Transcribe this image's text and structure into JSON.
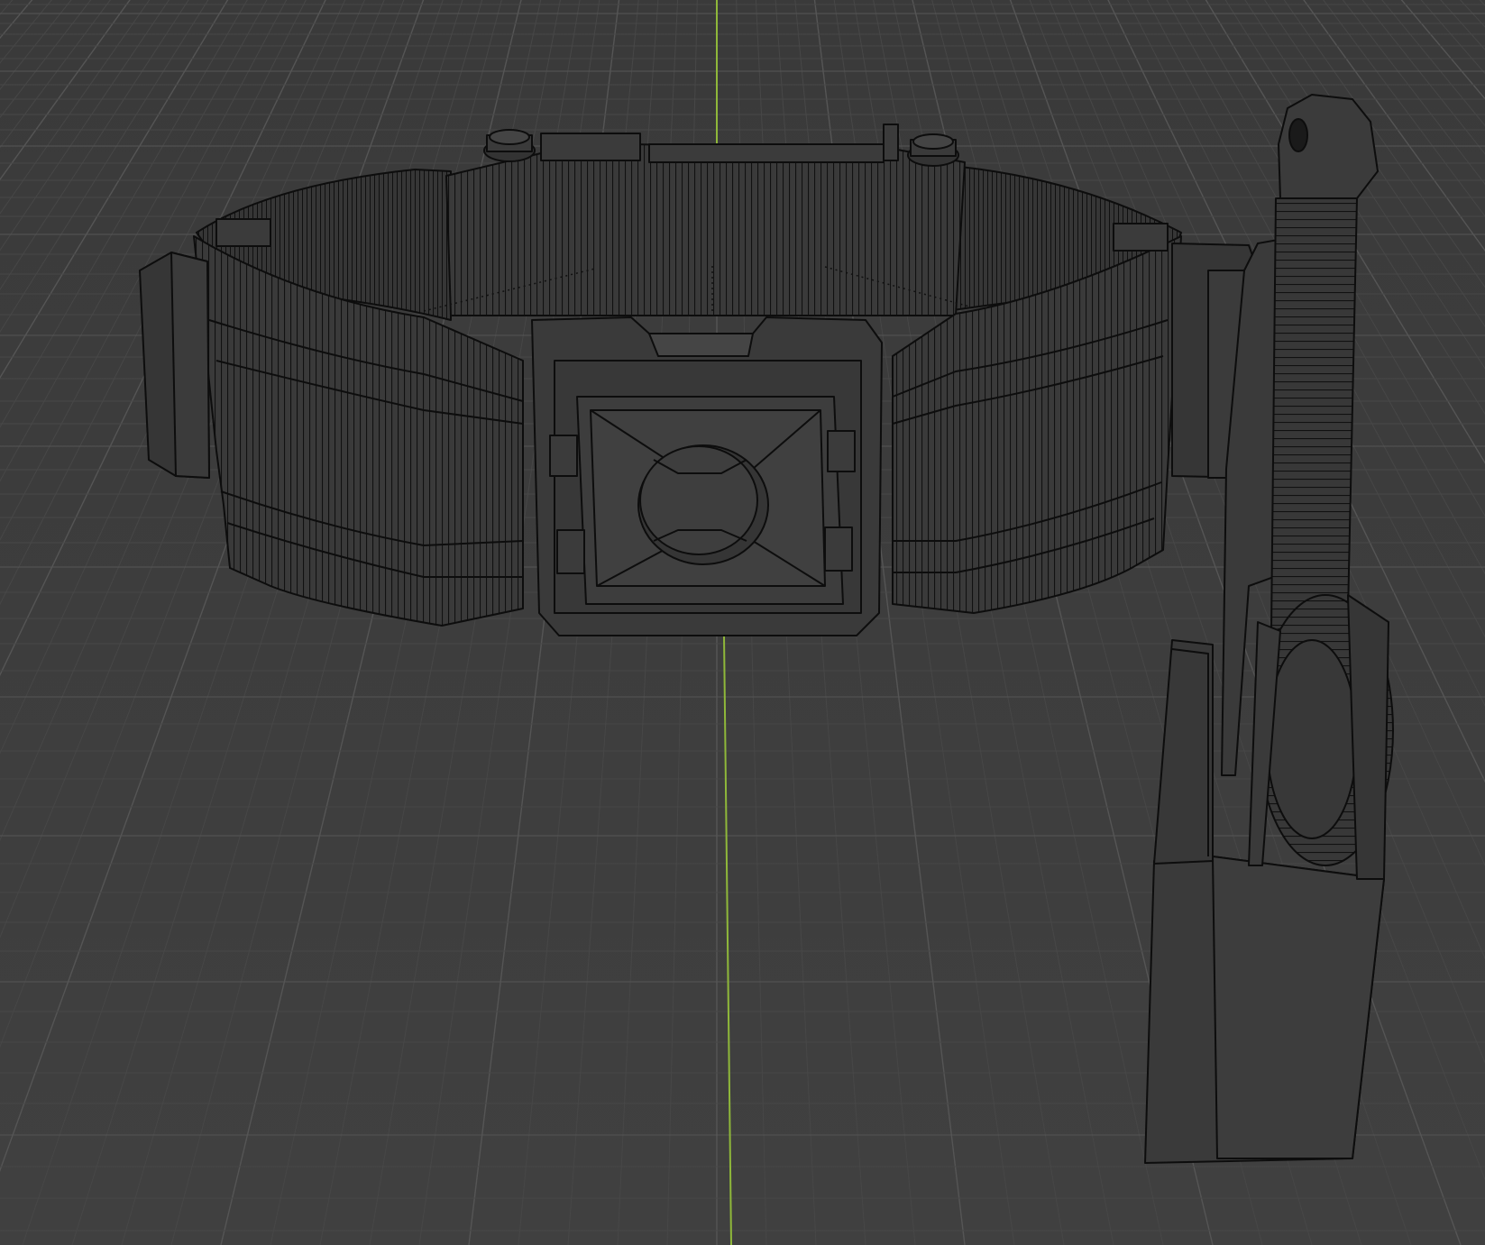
{
  "viewport": {
    "background_color": "#3b3b3b",
    "grid_color": "#555555",
    "grid_subcolor": "#474747",
    "y_axis_color": "#8fb83a",
    "mesh_fill": "#3d3d3d",
    "mesh_fill_dark": "#2e2e2e",
    "mesh_edge_color": "#0d0d0d",
    "shading": "wireframe-solid"
  },
  "scene": {
    "objects": [
      {
        "name": "belt",
        "icon": "mesh-icon"
      },
      {
        "name": "buckle",
        "icon": "mesh-icon"
      },
      {
        "name": "holster",
        "icon": "mesh-icon"
      },
      {
        "name": "tool",
        "icon": "mesh-icon"
      }
    ]
  }
}
